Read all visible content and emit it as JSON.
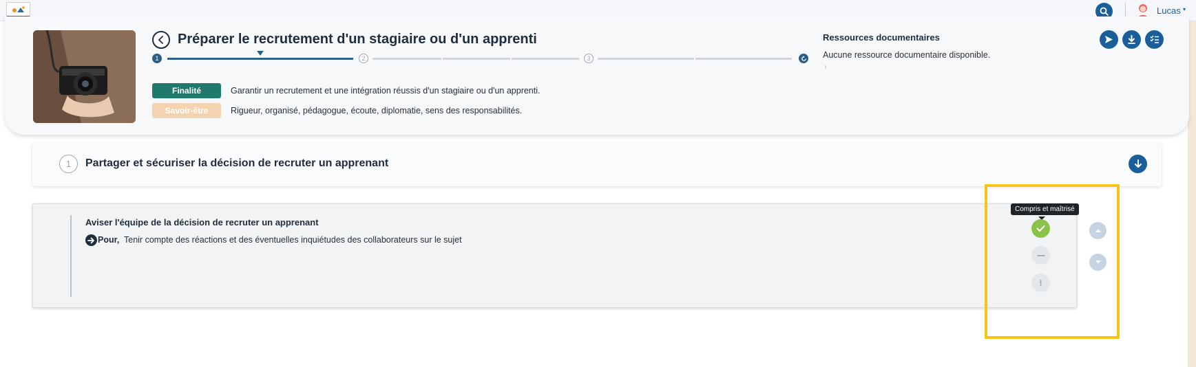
{
  "navbar": {
    "logo_icon": "app-logo",
    "search_icon": "search-icon",
    "user": {
      "name": "Lucas",
      "caret": "▾"
    }
  },
  "activity": {
    "title": "Préparer le recrutement d'un stagiaire ou d'un apprenti",
    "steps": [
      {
        "label": "1",
        "state": "done"
      },
      {
        "label": "2",
        "state": "idle"
      },
      {
        "label": "3",
        "state": "idle"
      },
      {
        "label": "restart-icon",
        "state": "done"
      }
    ],
    "finalite": {
      "label": "Finalité",
      "text": "Garantir un recrutement et une intégration réussis d'un stagiaire ou d'un apprenti."
    },
    "savoir_etre": {
      "label": "Savoir-être",
      "text": "Rigueur, organisé, pédagogue, écoute, diplomatie, sens des responsabilités."
    }
  },
  "resources": {
    "title": "Ressources documentaires",
    "empty_text": "Aucune ressource documentaire disponible.",
    "chevron": "›"
  },
  "actions": [
    "send-icon",
    "download-icon",
    "checklist-icon"
  ],
  "section": {
    "number": "1",
    "title": "Partager et sécuriser la décision de recruter un apprenant"
  },
  "task": {
    "title": "Aviser l'équipe de la décision de recruter un apprenant",
    "pour_label": "Pour,",
    "pour_text": "Tenir compte des réactions et des éventuelles inquiétudes des collaborateurs sur le sujet",
    "tooltip": "Compris et maîtrisé",
    "status_options": [
      "check-icon",
      "minus-icon",
      "exclamation-icon"
    ],
    "warn_glyph": "!"
  },
  "colors": {
    "primary": "#1a5f99",
    "finalite": "#1f7a6c",
    "savoir_etre": "#f3d3b0",
    "success": "#8bc34a",
    "highlight": "#f5c518"
  }
}
